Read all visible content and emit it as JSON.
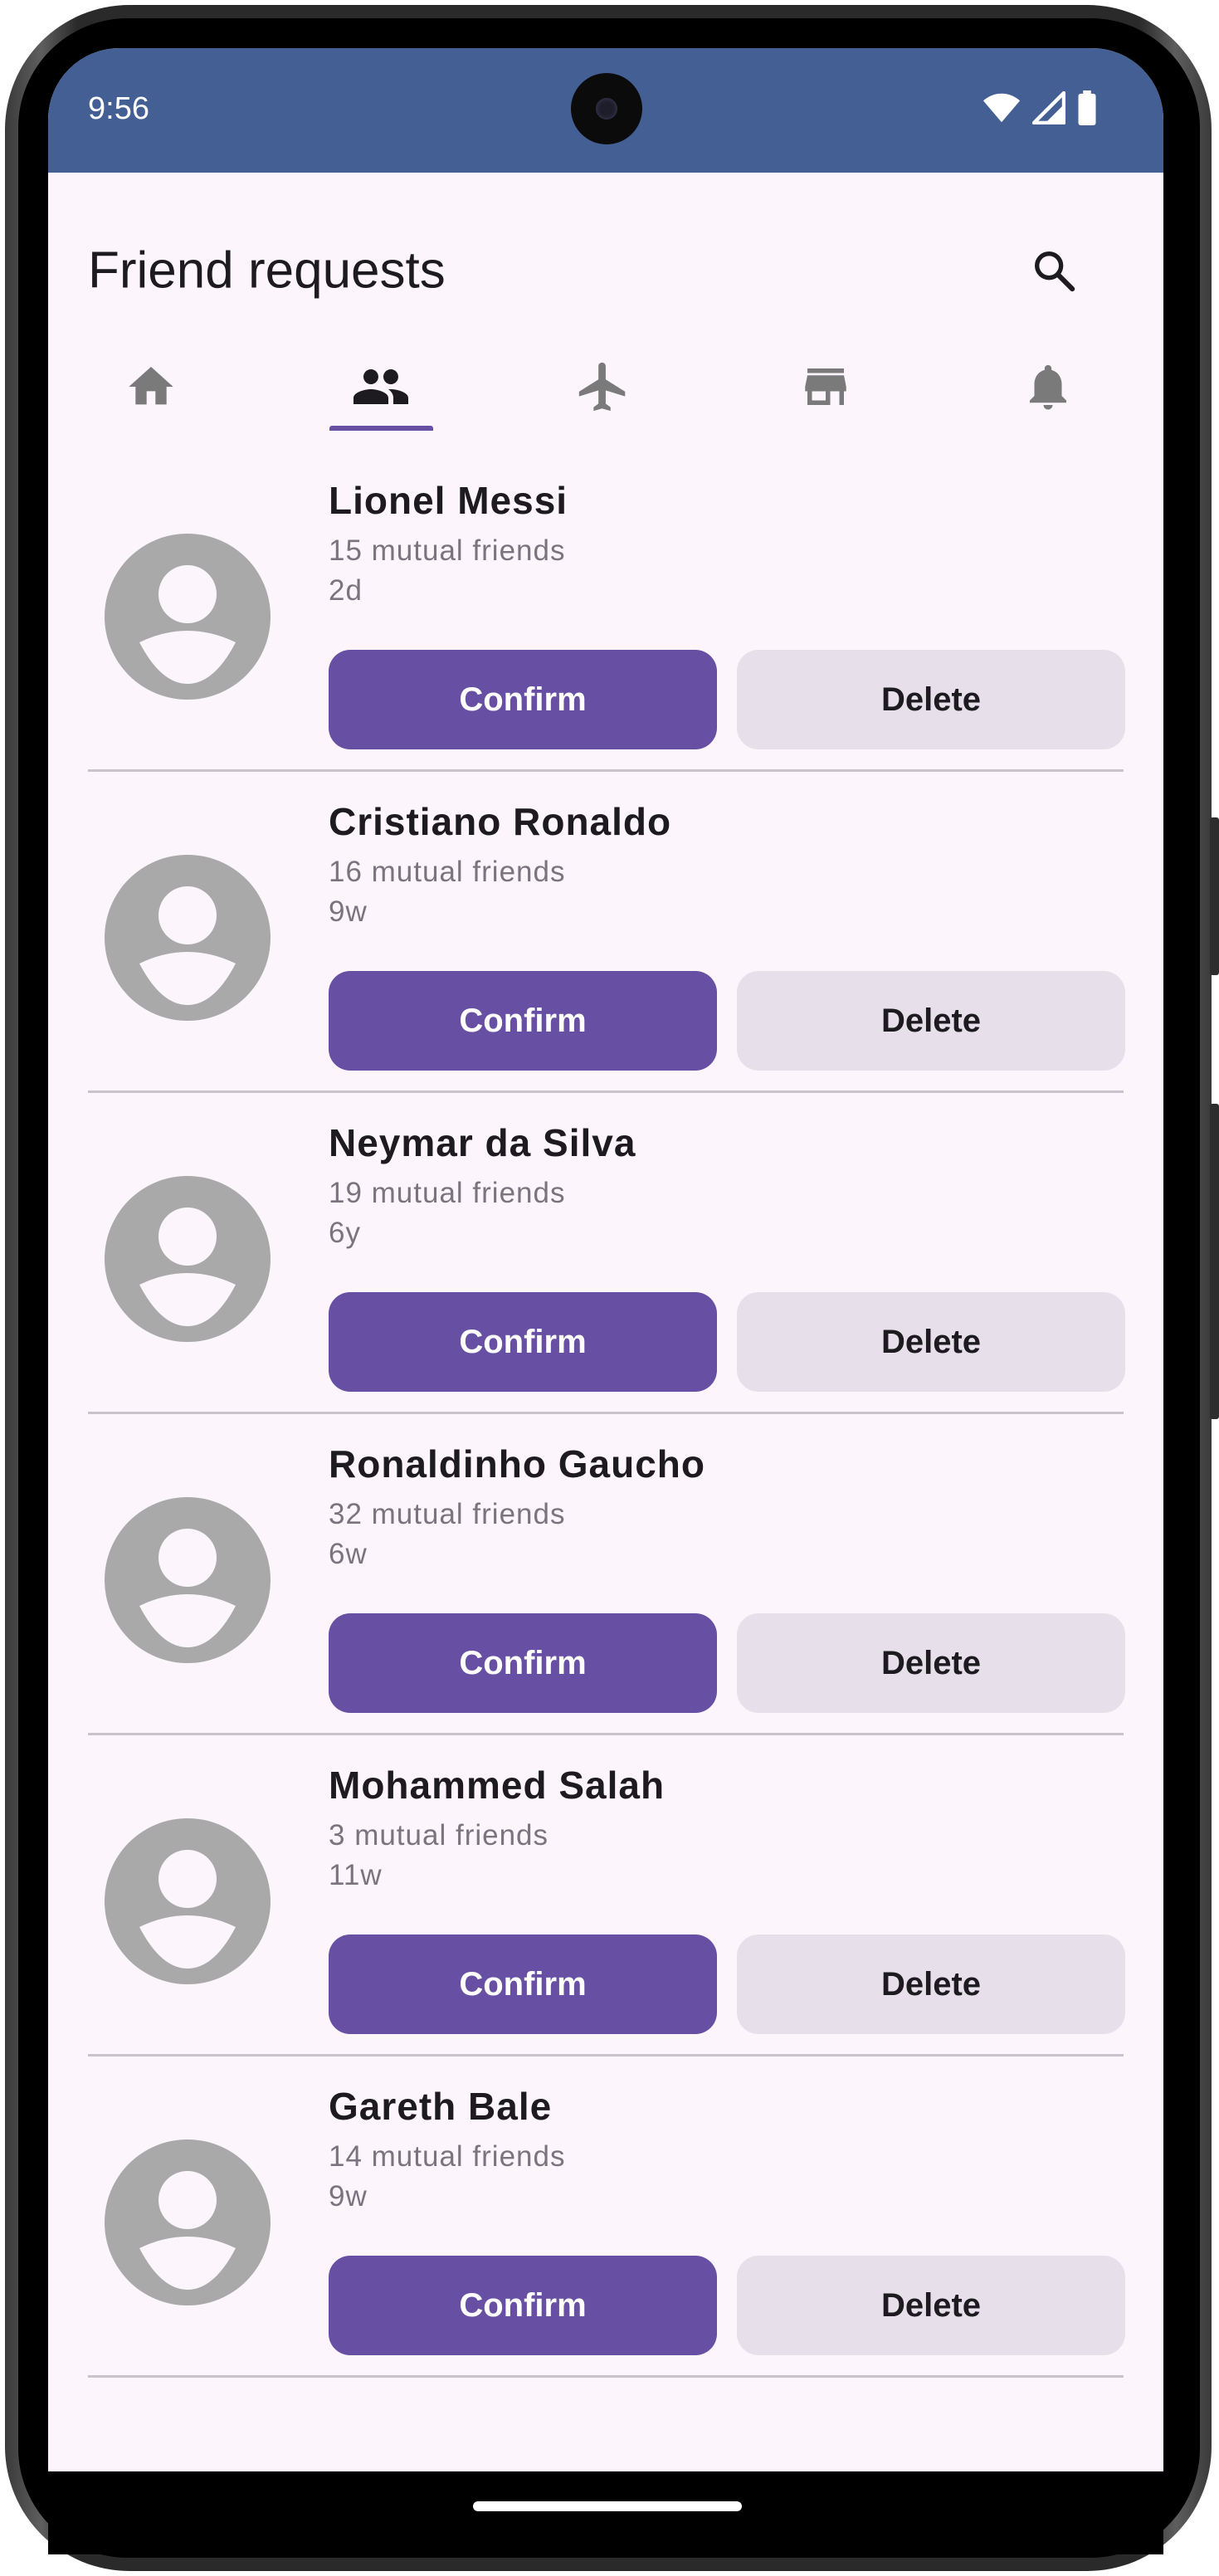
{
  "colors": {
    "status_bar": "#435f94",
    "accent": "#6750a4",
    "screen_bg": "#fcf5fb",
    "delete_bg": "#e7e0ea",
    "tab_inactive": "#7a7a7a",
    "tab_active": "#1d1b20",
    "avatar": "#a9a9a9"
  },
  "status_bar": {
    "time": "9:56",
    "icons": [
      "wifi-icon",
      "signal-icon",
      "battery-icon"
    ]
  },
  "app_bar": {
    "title": "Friend requests",
    "action_icon": "search-icon"
  },
  "tabs": {
    "selected": "friends",
    "items": [
      {
        "id": "home",
        "icon": "home-icon"
      },
      {
        "id": "friends",
        "icon": "people-icon"
      },
      {
        "id": "travel",
        "icon": "airplane-icon"
      },
      {
        "id": "store",
        "icon": "storefront-icon"
      },
      {
        "id": "notifications",
        "icon": "bell-icon"
      }
    ]
  },
  "requests": [
    {
      "name": "Lionel Messi",
      "mutual": "15 mutual friends",
      "time": "2d",
      "confirm_label": "Confirm",
      "delete_label": "Delete"
    },
    {
      "name": "Cristiano Ronaldo",
      "mutual": "16 mutual friends",
      "time": "9w",
      "confirm_label": "Confirm",
      "delete_label": "Delete"
    },
    {
      "name": "Neymar da Silva",
      "mutual": "19 mutual friends",
      "time": "6y",
      "confirm_label": "Confirm",
      "delete_label": "Delete"
    },
    {
      "name": "Ronaldinho Gaucho",
      "mutual": "32 mutual friends",
      "time": "6w",
      "confirm_label": "Confirm",
      "delete_label": "Delete"
    },
    {
      "name": "Mohammed Salah",
      "mutual": "3 mutual friends",
      "time": "11w",
      "confirm_label": "Confirm",
      "delete_label": "Delete"
    },
    {
      "name": "Gareth Bale",
      "mutual": "14 mutual friends",
      "time": "9w",
      "confirm_label": "Confirm",
      "delete_label": "Delete"
    }
  ]
}
